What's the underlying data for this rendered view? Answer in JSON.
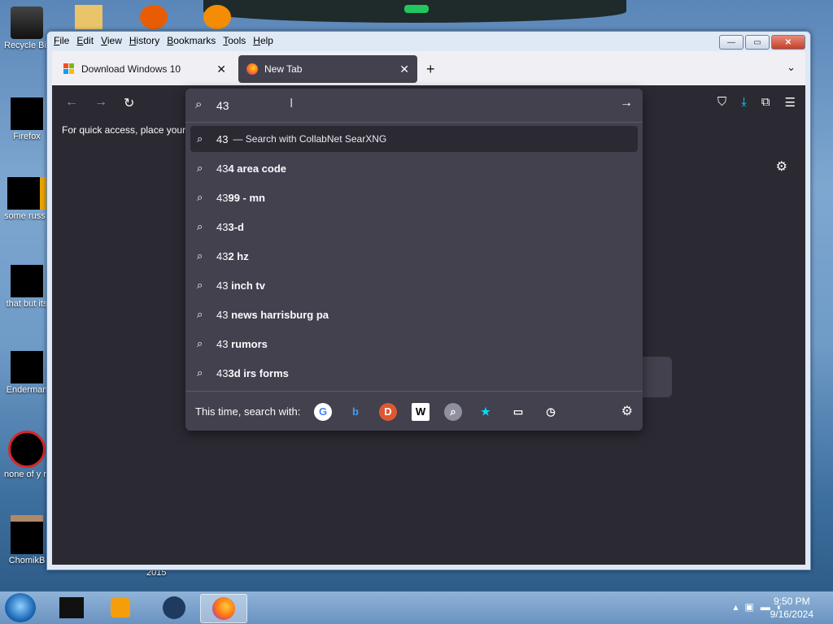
{
  "desktop": {
    "icons": [
      {
        "label": "Recycle Bin"
      },
      {
        "label": "Firefox"
      },
      {
        "label": "some russ ran a ra"
      },
      {
        "label": "that but its"
      },
      {
        "label": "Enderman"
      },
      {
        "label": "none of y retards kn"
      },
      {
        "label": "ChomikB"
      }
    ],
    "year_label": "2015"
  },
  "window": {
    "menu": [
      "File",
      "Edit",
      "View",
      "History",
      "Bookmarks",
      "Tools",
      "Help"
    ],
    "controls": {
      "minimize": "—",
      "maximize": "▭",
      "close": "✕"
    }
  },
  "tabs": [
    {
      "title": "Download Windows 10",
      "close": "✕"
    },
    {
      "title": "New Tab",
      "close": "✕"
    }
  ],
  "new_tab_symbol": "+",
  "tab_list_symbol": "⌄",
  "toolbar": {
    "bookmarks_hint": "For quick access, place your b"
  },
  "urlbar": {
    "value": "43",
    "suggestions": [
      {
        "typed": "43",
        "rest": "",
        "engine": "— Search with CollabNet SearXNG",
        "selected": true
      },
      {
        "typed": "43",
        "rest": "4 area code"
      },
      {
        "typed": "43",
        "rest": "99 - mn"
      },
      {
        "typed": "43",
        "rest": "3-d"
      },
      {
        "typed": "43",
        "rest": "2 hz"
      },
      {
        "typed": "43",
        "rest": " inch tv"
      },
      {
        "typed": "43",
        "rest": " news harrisburg pa"
      },
      {
        "typed": "43",
        "rest": " rumors"
      },
      {
        "typed": "43",
        "rest": "3d irs forms"
      }
    ],
    "one_off_label": "This time, search with:",
    "engines": [
      {
        "name": "google-icon",
        "glyph": "G",
        "color": "#4285f4",
        "bg": "#ffffff"
      },
      {
        "name": "bing-icon",
        "glyph": "b",
        "color": "#3aa0f0",
        "bg": "transparent"
      },
      {
        "name": "duckduckgo-icon",
        "glyph": "D",
        "color": "#ffffff",
        "bg": "#de5833"
      },
      {
        "name": "wikipedia-icon",
        "glyph": "W",
        "color": "#000000",
        "bg": "#ffffff"
      },
      {
        "name": "searxng-icon",
        "glyph": "⌕",
        "color": "#ffffff",
        "bg": "#8f8f9d"
      },
      {
        "name": "bookmarks-star-icon",
        "glyph": "★",
        "color": "#00ddff",
        "bg": "transparent"
      },
      {
        "name": "tabs-icon",
        "glyph": "▭",
        "color": "#fbfbfe",
        "bg": "transparent"
      },
      {
        "name": "history-clock-icon",
        "glyph": "◷",
        "color": "#fbfbfe",
        "bg": "transparent"
      }
    ]
  },
  "taskbar": {
    "time": "9:50 PM",
    "date": "9/16/2024"
  },
  "colors": {
    "panel_bg": "#42414d",
    "page_bg": "#2b2a33",
    "text": "#fbfbfe",
    "download_accent": "#00ddff"
  }
}
